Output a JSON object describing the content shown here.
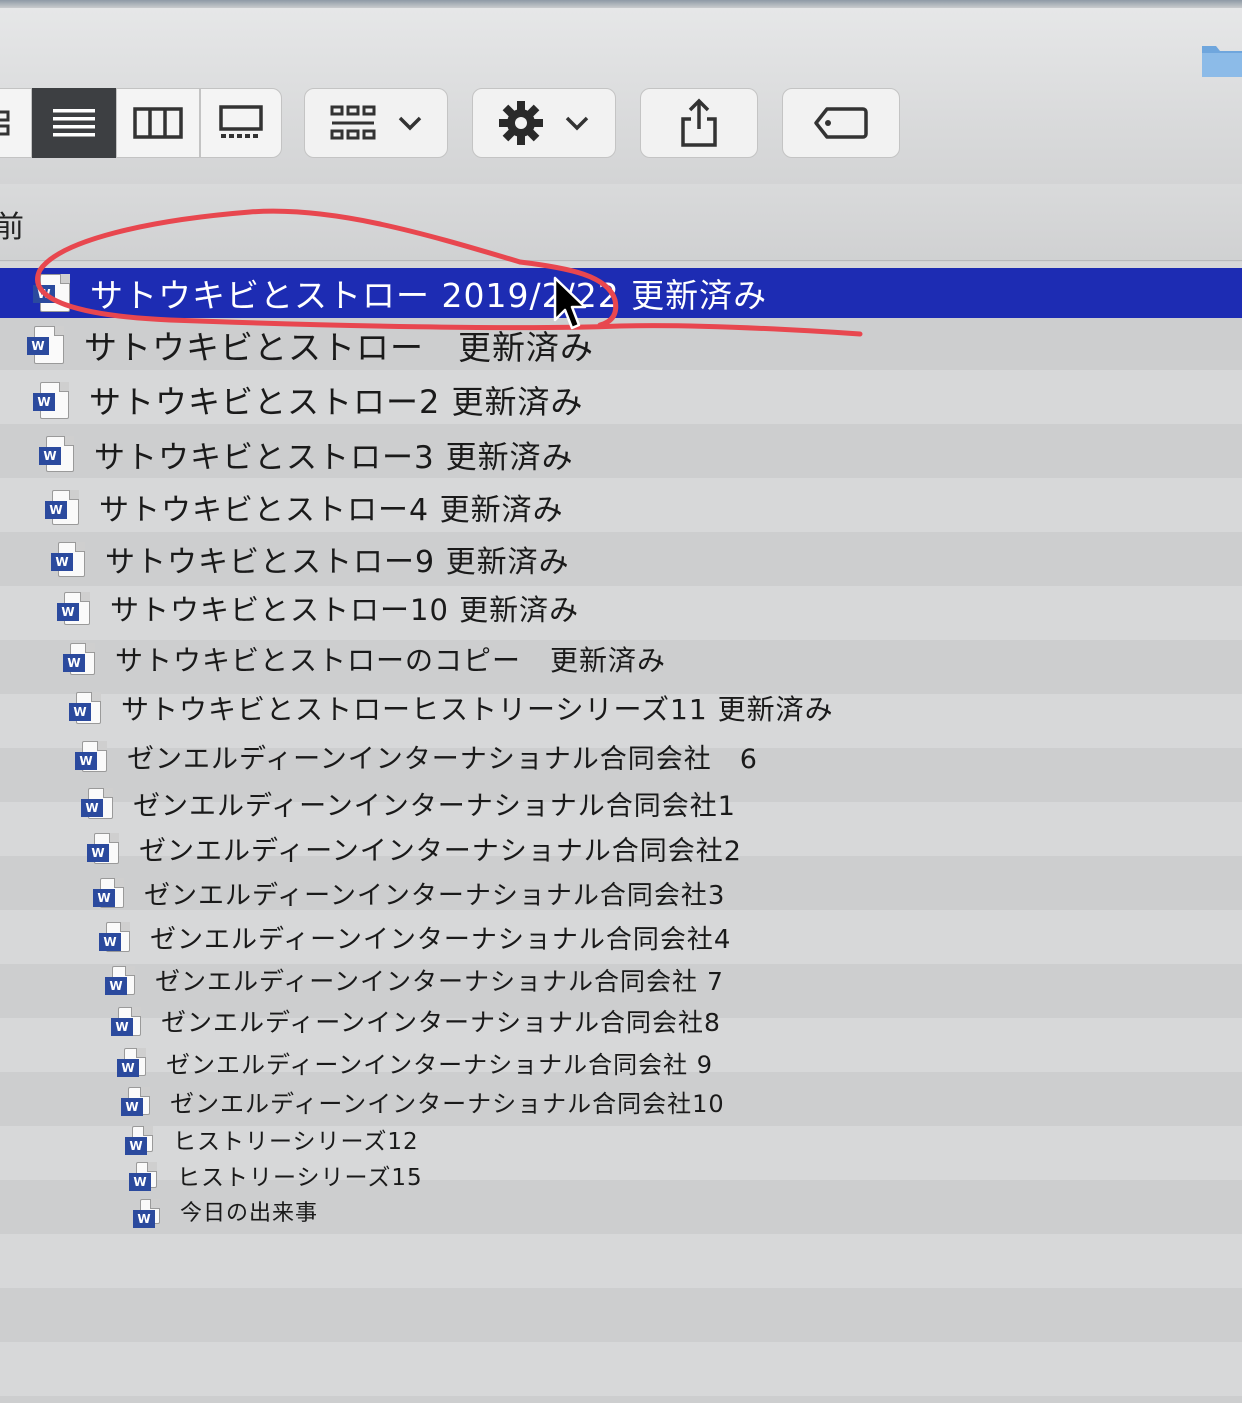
{
  "header": {
    "column_name": "前"
  },
  "toolbar": {
    "view_buttons": [
      "icon-view",
      "list-view",
      "column-view",
      "gallery-view"
    ],
    "group_button": "group-by",
    "action_button": "action-gear",
    "share_button": "share",
    "tag_button": "tags"
  },
  "files": [
    {
      "name": "サトウキビとストロー 2019/2/22 更新済み",
      "selected": true
    },
    {
      "name": "サトウキビとストロー　更新済み"
    },
    {
      "name": "サトウキビとストロー2 更新済み"
    },
    {
      "name": "サトウキビとストロー3 更新済み"
    },
    {
      "name": "サトウキビとストロー4 更新済み"
    },
    {
      "name": "サトウキビとストロー9 更新済み"
    },
    {
      "name": "サトウキビとストロー10 更新済み"
    },
    {
      "name": "サトウキビとストローのコピー　更新済み"
    },
    {
      "name": "サトウキビとストローヒストリーシリーズ11 更新済み"
    },
    {
      "name": "ゼンエルディーンインターナショナル合同会社　6"
    },
    {
      "name": "ゼンエルディーンインターナショナル合同会社1"
    },
    {
      "name": "ゼンエルディーンインターナショナル合同会社2"
    },
    {
      "name": "ゼンエルディーンインターナショナル合同会社3"
    },
    {
      "name": "ゼンエルディーンインターナショナル合同会社4"
    },
    {
      "name": "ゼンエルディーンインターナショナル合同会社 7"
    },
    {
      "name": "ゼンエルディーンインターナショナル合同会社8"
    },
    {
      "name": "ゼンエルディーンインターナショナル合同会社 9"
    },
    {
      "name": "ゼンエルディーンインターナショナル合同会社10"
    },
    {
      "name": "ヒストリーシリーズ12"
    },
    {
      "name": "ヒストリーシリーズ15"
    },
    {
      "name": "今日の出来事"
    }
  ],
  "file_icon": {
    "name": "word-document-icon",
    "badge": "W"
  },
  "colors": {
    "selection": "#1d2cb3",
    "annotation": "#e8474f",
    "word_blue": "#2b4a9e"
  }
}
